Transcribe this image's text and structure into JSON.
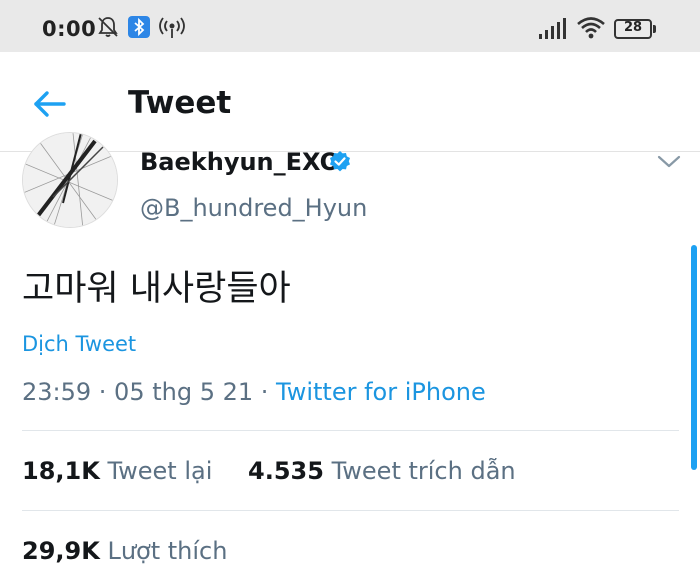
{
  "status_bar": {
    "time": "0:00",
    "battery": "28",
    "icons": [
      "bell-off-icon",
      "bluetooth-icon",
      "hotspot-icon",
      "signal-icon",
      "wifi-icon",
      "battery-icon"
    ]
  },
  "header": {
    "title": "Tweet",
    "back_icon": "arrow-left-icon"
  },
  "tweet": {
    "author_name": "Baekhyun_EXO",
    "author_handle": "@B_hundred_Hyun",
    "text": "고마워 내사랑들아",
    "translate_label": "Dịch Tweet",
    "timestamp": "23:59 · 05 thg 5 21 · ",
    "source": "Twitter for iPhone"
  },
  "stats": {
    "retweets_count": "18,1K",
    "retweets_label": "Tweet lại",
    "quotes_count": "4.535",
    "quotes_label": "Tweet trích dẫn",
    "likes_count": "29,9K",
    "likes_label": "Lượt thích"
  },
  "colors": {
    "accent": "#1b95e0",
    "muted": "#5b7083",
    "text": "#14171a"
  }
}
